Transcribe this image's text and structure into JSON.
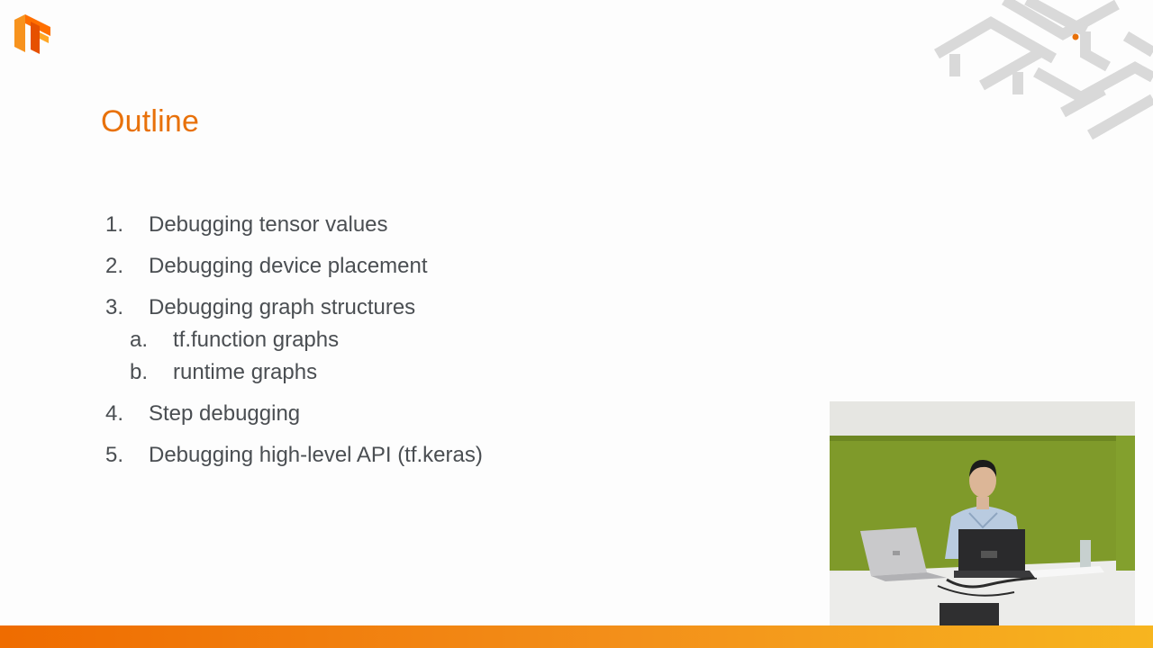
{
  "slide": {
    "title": "Outline",
    "items": [
      {
        "num": "1.",
        "label": "Debugging tensor values"
      },
      {
        "num": "2.",
        "label": "Debugging device placement"
      },
      {
        "num": "3.",
        "label": "Debugging graph structures"
      },
      {
        "num": "4.",
        "label": "Step debugging"
      },
      {
        "num": "5.",
        "label": "Debugging high-level API (tf.keras)"
      }
    ],
    "subitems": [
      {
        "num": "a.",
        "label": "tf.function graphs"
      },
      {
        "num": "b.",
        "label": "runtime graphs"
      }
    ]
  },
  "colors": {
    "title": "#e8710a",
    "text": "#4a4e52",
    "bar_start": "#ef6c00",
    "bar_end": "#f7b51f",
    "wall_green": "#7f9a2a"
  },
  "icons": {
    "logo": "tensorflow-logo",
    "decoration": "maze-graphic"
  }
}
